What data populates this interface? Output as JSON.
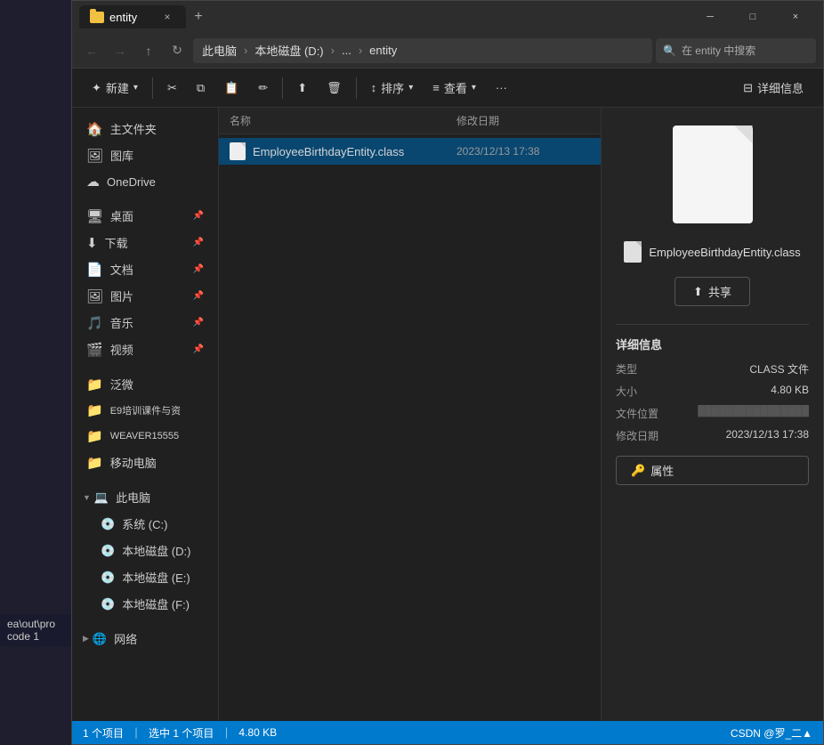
{
  "window": {
    "title": "entity",
    "tab_label": "entity",
    "close_label": "×",
    "new_tab_label": "+",
    "minimize_label": "─",
    "maximize_label": "□",
    "window_close_label": "×"
  },
  "nav": {
    "back_icon": "←",
    "forward_icon": "→",
    "up_icon": "↑",
    "refresh_icon": "↻",
    "path_segments": [
      "此电脑",
      "本地磁盘 (D:)",
      "...",
      "entity"
    ],
    "search_placeholder": "在 entity 中搜索"
  },
  "toolbar": {
    "new_label": "✦ 新建",
    "new_arrow": "∨",
    "cut_icon": "✂",
    "copy_icon": "⧉",
    "paste_icon": "⬜",
    "rename_icon": "✎",
    "share_icon": "⬆",
    "delete_icon": "🗑",
    "sort_label": "排序",
    "view_label": "查看",
    "more_icon": "···",
    "details_label": "详细信息"
  },
  "sidebar": {
    "items": [
      {
        "icon": "🏠",
        "label": "主文件夹",
        "pin": false
      },
      {
        "icon": "🖼",
        "label": "图库",
        "pin": false
      },
      {
        "icon": "☁",
        "label": "OneDrive",
        "pin": false
      },
      {
        "icon": "🖥",
        "label": "桌面",
        "pin": true
      },
      {
        "icon": "⬇",
        "label": "下载",
        "pin": true
      },
      {
        "icon": "📄",
        "label": "文档",
        "pin": true
      },
      {
        "icon": "🖼",
        "label": "图片",
        "pin": true
      },
      {
        "icon": "🎵",
        "label": "音乐",
        "pin": true
      },
      {
        "icon": "🎬",
        "label": "视频",
        "pin": true
      },
      {
        "icon": "📁",
        "label": "泛微",
        "pin": false
      },
      {
        "icon": "📁",
        "label": "E9培训课件与资",
        "pin": false
      },
      {
        "icon": "📁",
        "label": "WEAVER15555",
        "pin": false
      },
      {
        "icon": "📁",
        "label": "移动电脑",
        "pin": false
      }
    ],
    "this_pc": {
      "label": "此电脑",
      "icon": "💻",
      "drives": [
        {
          "icon": "💿",
          "label": "系统 (C:)"
        },
        {
          "icon": "💿",
          "label": "本地磁盘 (D:)"
        },
        {
          "icon": "💿",
          "label": "本地磁盘 (E:)"
        },
        {
          "icon": "💿",
          "label": "本地磁盘 (F:)"
        }
      ]
    },
    "network": {
      "label": "网络",
      "icon": "🌐"
    }
  },
  "file_list": {
    "col_name": "名称",
    "col_date": "修改日期",
    "files": [
      {
        "name": "EmployeeBirthdayEntity.class",
        "date": "2023/12/13 17:38",
        "selected": true
      }
    ]
  },
  "detail_panel": {
    "file_name": "EmployeeBirthdayEntity.class",
    "share_label": "共享",
    "info_title": "详细信息",
    "fields": [
      {
        "label": "类型",
        "value": "CLASS 文件"
      },
      {
        "label": "大小",
        "value": "4.80 KB"
      },
      {
        "label": "文件位置",
        "value": "████████████████"
      },
      {
        "label": "修改日期",
        "value": "2023/12/13 17:38"
      }
    ],
    "attr_label": "属性"
  },
  "status_bar": {
    "count_text": "1 个项目",
    "selected_text": "选中 1 个项目",
    "size_text": "4.80 KB",
    "right_text": "CSDN @罗_二▲"
  },
  "terminal": {
    "line1": "ea\\out\\pro",
    "line2": " code 1"
  }
}
